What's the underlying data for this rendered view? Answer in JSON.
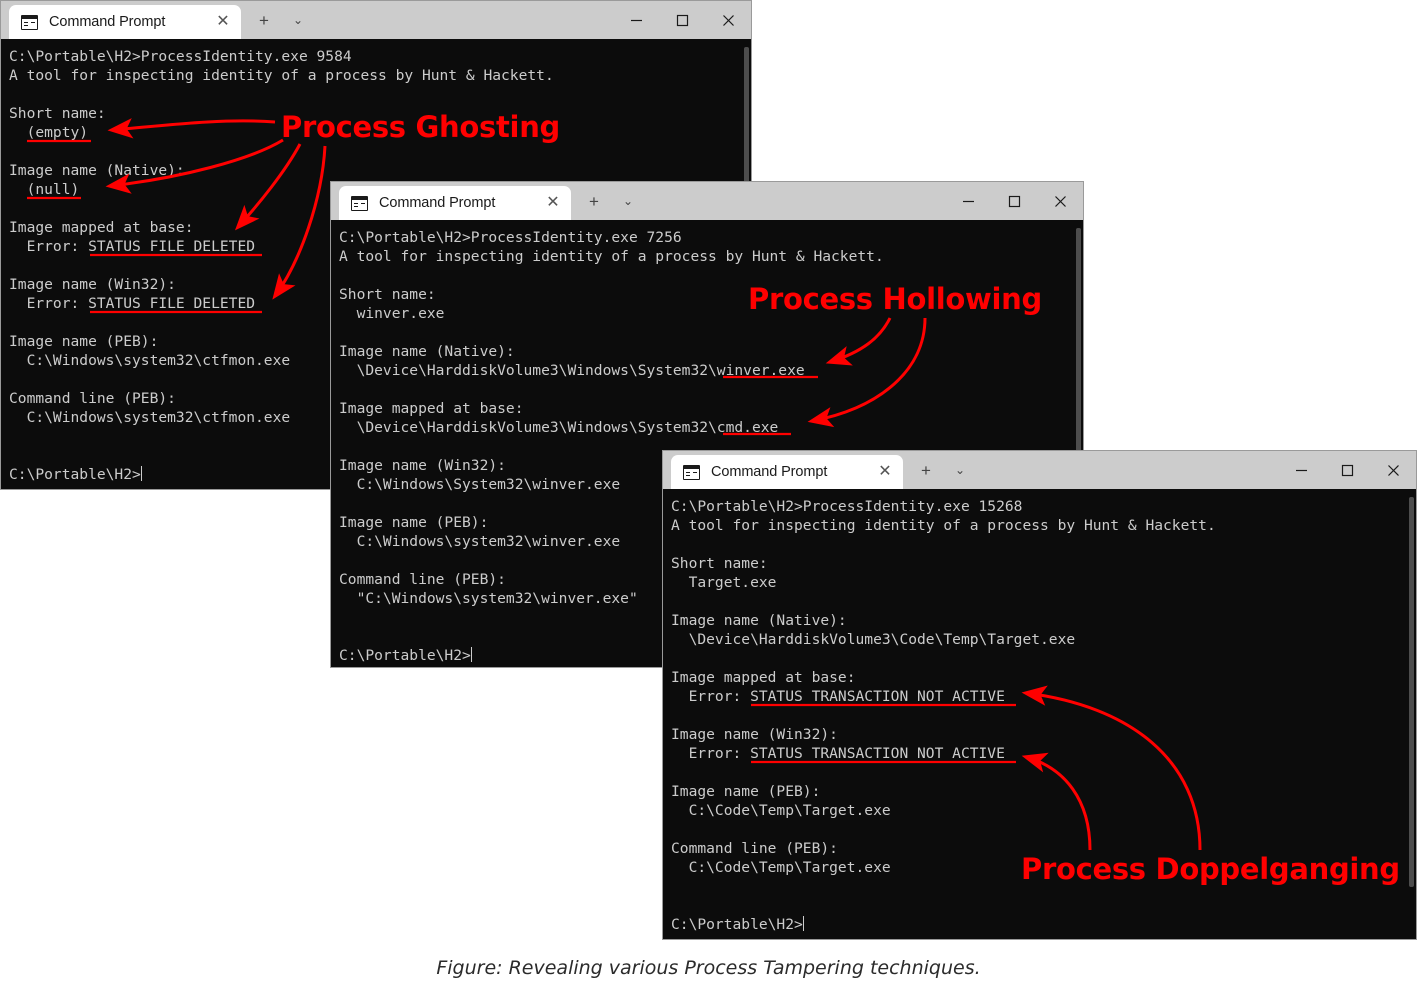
{
  "page": {
    "background": "#ffffff",
    "caption": "Figure: Revealing various Process Tampering techniques.",
    "accent_color": "#ff0000",
    "terminal_bg": "#0c0c0c",
    "terminal_fg": "#cccccc",
    "titlebar_bg": "#cccccc"
  },
  "windows": [
    {
      "id": "window-ghosting",
      "tab": {
        "icon": "cmd-icon",
        "title": "Command Prompt",
        "close_label": "✕"
      },
      "tab_buttons": {
        "new_tab": "+",
        "dropdown": "⌄"
      },
      "controls": {
        "minimize": "─",
        "maximize": "□",
        "close": "✕"
      },
      "lines": [
        "C:\\Portable\\H2>ProcessIdentity.exe 9584",
        "A tool for inspecting identity of a process by Hunt & Hackett.",
        "",
        "Short name:",
        "  (empty)",
        "",
        "Image name (Native):",
        "  (null)",
        "",
        "Image mapped at base:",
        "  Error: STATUS_FILE_DELETED",
        "",
        "Image name (Win32):",
        "  Error: STATUS_FILE_DELETED",
        "",
        "Image name (PEB):",
        "  C:\\Windows\\system32\\ctfmon.exe",
        "",
        "Command line (PEB):",
        "  C:\\Windows\\system32\\ctfmon.exe",
        "",
        ""
      ],
      "prompt": "C:\\Portable\\H2>"
    },
    {
      "id": "window-hollowing",
      "tab": {
        "icon": "cmd-icon",
        "title": "Command Prompt",
        "close_label": "✕"
      },
      "tab_buttons": {
        "new_tab": "+",
        "dropdown": "⌄"
      },
      "controls": {
        "minimize": "─",
        "maximize": "□",
        "close": "✕"
      },
      "lines": [
        "C:\\Portable\\H2>ProcessIdentity.exe 7256",
        "A tool for inspecting identity of a process by Hunt & Hackett.",
        "",
        "Short name:",
        "  winver.exe",
        "",
        "Image name (Native):",
        "  \\Device\\HarddiskVolume3\\Windows\\System32\\winver.exe",
        "",
        "Image mapped at base:",
        "  \\Device\\HarddiskVolume3\\Windows\\System32\\cmd.exe",
        "",
        "Image name (Win32):",
        "  C:\\Windows\\System32\\winver.exe",
        "",
        "Image name (PEB):",
        "  C:\\Windows\\system32\\winver.exe",
        "",
        "Command line (PEB):",
        "  \"C:\\Windows\\system32\\winver.exe\"",
        "",
        ""
      ],
      "prompt": "C:\\Portable\\H2>"
    },
    {
      "id": "window-doppelganging",
      "tab": {
        "icon": "cmd-icon",
        "title": "Command Prompt",
        "close_label": "✕"
      },
      "tab_buttons": {
        "new_tab": "+",
        "dropdown": "⌄"
      },
      "controls": {
        "minimize": "─",
        "maximize": "□",
        "close": "✕"
      },
      "lines": [
        "C:\\Portable\\H2>ProcessIdentity.exe 15268",
        "A tool for inspecting identity of a process by Hunt & Hackett.",
        "",
        "Short name:",
        "  Target.exe",
        "",
        "Image name (Native):",
        "  \\Device\\HarddiskVolume3\\Code\\Temp\\Target.exe",
        "",
        "Image mapped at base:",
        "  Error: STATUS_TRANSACTION_NOT_ACTIVE",
        "",
        "Image name (Win32):",
        "  Error: STATUS_TRANSACTION_NOT_ACTIVE",
        "",
        "Image name (PEB):",
        "  C:\\Code\\Temp\\Target.exe",
        "",
        "Command line (PEB):",
        "  C:\\Code\\Temp\\Target.exe",
        "",
        ""
      ],
      "prompt": "C:\\Portable\\H2>"
    }
  ],
  "annotations": [
    {
      "id": "annot-ghosting",
      "label": "Process Ghosting"
    },
    {
      "id": "annot-hollowing",
      "label": "Process Hollowing"
    },
    {
      "id": "annot-doppelganging",
      "label": "Process Doppelganging"
    }
  ],
  "highlighted_values": {
    "ghosting": [
      "(empty)",
      "(null)",
      "STATUS_FILE_DELETED",
      "STATUS_FILE_DELETED"
    ],
    "hollowing": [
      "winver.exe",
      "cmd.exe"
    ],
    "doppelganging": [
      "STATUS_TRANSACTION_NOT_ACTIVE",
      "STATUS_TRANSACTION_NOT_ACTIVE"
    ]
  }
}
